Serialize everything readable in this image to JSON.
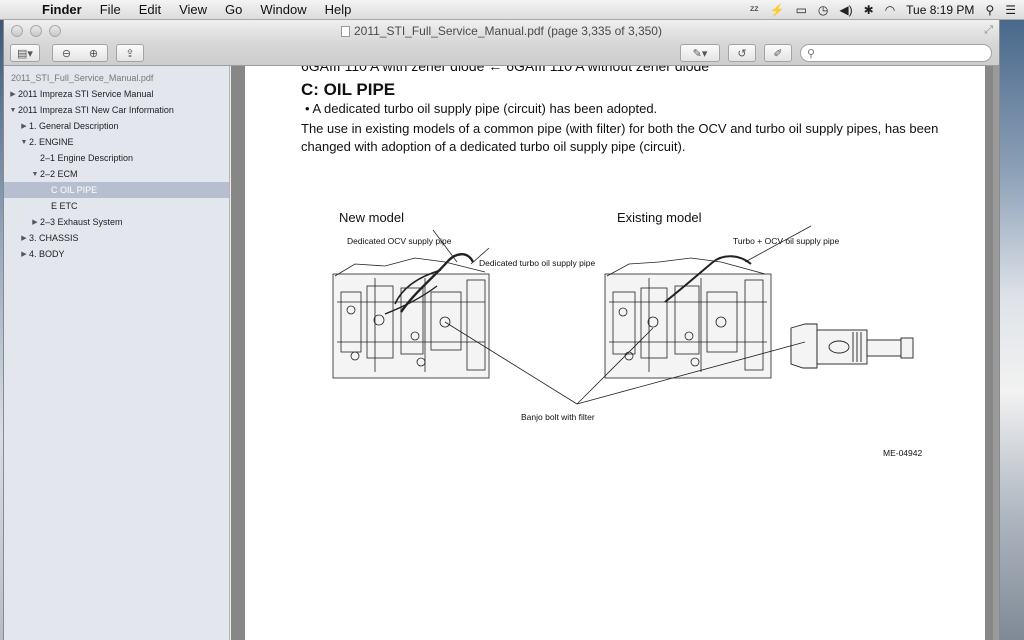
{
  "menubar": {
    "app_name": "Finder",
    "items": [
      "File",
      "Edit",
      "View",
      "Go",
      "Window",
      "Help"
    ],
    "clock": "Tue 8:19 PM"
  },
  "window": {
    "title": "2011_STI_Full_Service_Manual.pdf (page 3,335 of 3,350)"
  },
  "toolbar": {
    "search_placeholder": ""
  },
  "sidebar": {
    "file_name": "2011_STI_Full_Service_Manual.pdf",
    "items": [
      {
        "label": "2011 Impreza STI Service Manual",
        "indent": 0,
        "expand": "collapsed"
      },
      {
        "label": "2011 Impreza STI New Car Information",
        "indent": 0,
        "expand": "expanded"
      },
      {
        "label": "1. General Description",
        "indent": 1,
        "expand": "collapsed"
      },
      {
        "label": "2. ENGINE",
        "indent": 1,
        "expand": "expanded"
      },
      {
        "label": "2–1 Engine Description",
        "indent": 2,
        "expand": "none"
      },
      {
        "label": "2–2 ECM",
        "indent": 2,
        "expand": "expanded"
      },
      {
        "label": "C OIL PIPE",
        "indent": 3,
        "expand": "none",
        "selected": true
      },
      {
        "label": "E ETC",
        "indent": 3,
        "expand": "none"
      },
      {
        "label": "2–3 Exhaust System",
        "indent": 2,
        "expand": "collapsed"
      },
      {
        "label": "3. CHASSIS",
        "indent": 1,
        "expand": "collapsed"
      },
      {
        "label": "4. BODY",
        "indent": 1,
        "expand": "collapsed"
      }
    ]
  },
  "document": {
    "truncated_line": "6GAIII 110 A with zener diode ← 6GAIII 110 A without zener diode",
    "section_title": "C:  OIL PIPE",
    "bullet": "• A dedicated turbo oil supply pipe (circuit) has been adopted.",
    "paragraph": "The use in existing models of a common pipe (with filter) for both the OCV and turbo oil supply pipes, has been changed with adoption of a dedicated turbo oil supply pipe (circuit).",
    "figure": {
      "new_model_label": "New model",
      "existing_model_label": "Existing model",
      "callout_ocv": "Dedicated OCV supply pipe",
      "callout_turbo": "Dedicated turbo oil supply pipe",
      "callout_common": "Turbo + OCV oil supply pipe",
      "callout_banjo": "Banjo bolt with filter",
      "figure_id": "ME-04942"
    }
  }
}
